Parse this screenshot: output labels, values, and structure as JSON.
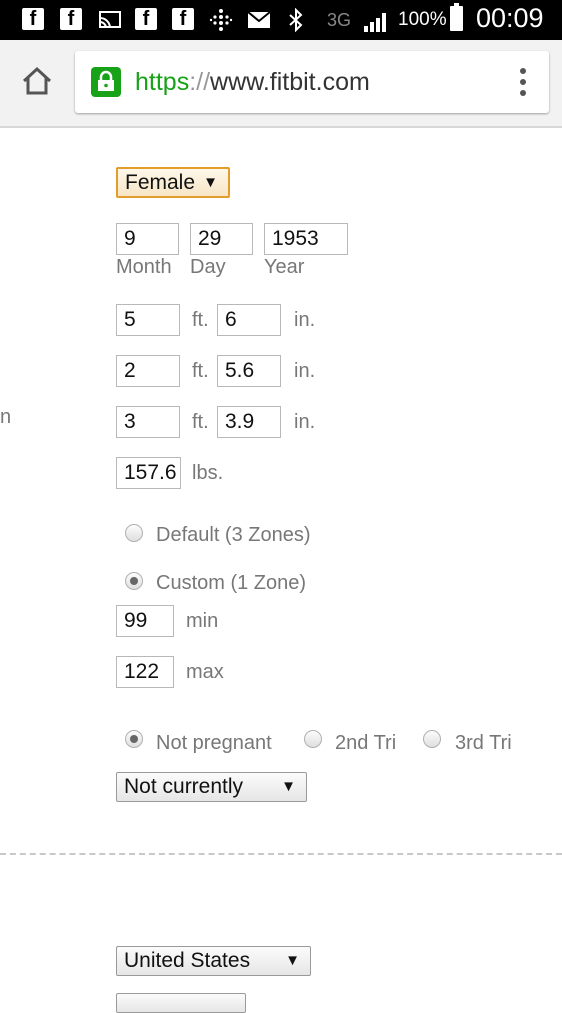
{
  "statusbar": {
    "icons": [
      "facebook-icon",
      "facebook-icon",
      "cast-icon",
      "facebook-icon",
      "facebook-icon",
      "fitbit-icon",
      "mail-icon",
      "bluetooth-icon"
    ],
    "network": "3G",
    "battery": "100%",
    "time": "00:09"
  },
  "browser": {
    "url_scheme": "https",
    "url_sep": "://",
    "url_host": "www.fitbit.com"
  },
  "form": {
    "sex": "Female",
    "birth": {
      "month": "9",
      "day": "29",
      "year": "1953",
      "month_label": "Month",
      "day_label": "Day",
      "year_label": "Year"
    },
    "height": {
      "ft": "5",
      "in": "6"
    },
    "stride_walk": {
      "ft": "2",
      "in": "5.6"
    },
    "stride_run": {
      "ft": "3",
      "in": "3.9"
    },
    "unit_ft": "ft.",
    "unit_in": "in.",
    "weight": "157.6",
    "weight_unit": "lbs.",
    "zones": {
      "default_label": "Default (3 Zones)",
      "custom_label": "Custom (1 Zone)",
      "selected": "custom",
      "min": "99",
      "min_label": "min",
      "max": "122",
      "max_label": "max"
    },
    "pregnancy": {
      "options": [
        "Not pregnant",
        "2nd Tri",
        "3rd Tri"
      ],
      "selected": "Not pregnant"
    },
    "nursing": "Not currently",
    "country": "United States",
    "clipped_label": "n"
  }
}
